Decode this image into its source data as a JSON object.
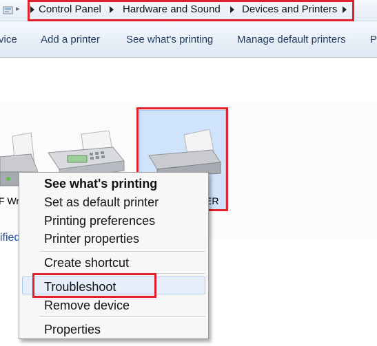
{
  "breadcrumb": {
    "items": [
      "Control Panel",
      "Hardware and Sound",
      "Devices and Printers"
    ]
  },
  "toolbar": {
    "items": [
      "vice",
      "Add a printer",
      "See what's printing",
      "Manage default printers",
      "P"
    ]
  },
  "devices": {
    "labels": [
      "F Wr",
      "ER"
    ],
    "link_text": "ified"
  },
  "context_menu": {
    "items": [
      "See what's printing",
      "Set as default printer",
      "Printing preferences",
      "Printer properties",
      "Create shortcut",
      "Troubleshoot",
      "Remove device",
      "Properties"
    ]
  },
  "colors": {
    "highlight": "#e0202c",
    "selection": "#cfe3fb",
    "toolbar_text": "#1e395b",
    "link": "#1f4fa8"
  }
}
